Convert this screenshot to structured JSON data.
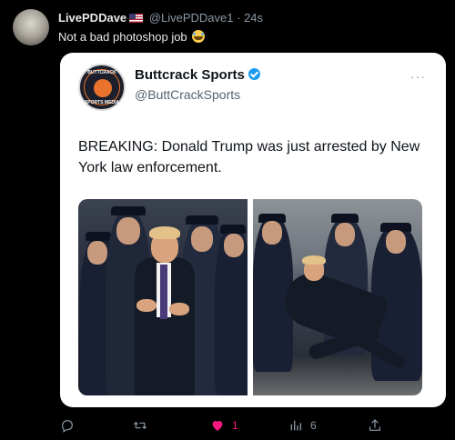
{
  "tweet": {
    "author_name": "LivePDDave",
    "author_handle": "@LivePDDave1",
    "separator": "·",
    "time": "24s",
    "text": "Not a bad photoshop job",
    "emoji": "face-with-tears-of-joy"
  },
  "quoted": {
    "name": "Buttcrack Sports",
    "handle": "@ButtCrackSports",
    "logo_text_top": "BUTTCRACK",
    "logo_text_bottom": "SPORTS MEDIA",
    "more": "···",
    "text": "BREAKING: Donald Trump was just arrested by New York law enforcement."
  },
  "actions": {
    "reply_icon": "reply-icon",
    "retweet_icon": "retweet-icon",
    "like_icon": "heart-icon",
    "like_count": "1",
    "views_icon": "views-icon",
    "views_count": "6",
    "share_icon": "share-icon"
  },
  "colors": {
    "background": "#000000",
    "like": "#f91880",
    "verified": "#1d9bf0",
    "muted": "#8b98a5"
  }
}
